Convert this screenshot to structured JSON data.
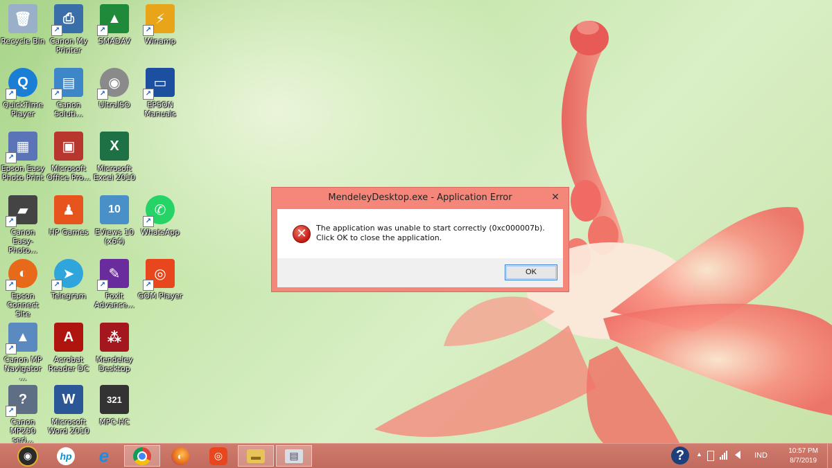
{
  "desktop_icons": [
    {
      "label": "Recycle Bin",
      "icon": "recycle-bin-icon",
      "color": "#9ab0c8",
      "glyph": "🗑"
    },
    {
      "label": "Canon My Printer",
      "icon": "printer-icon",
      "color": "#3a6ea8",
      "glyph": "⎙"
    },
    {
      "label": "SMADAV",
      "icon": "smadav-icon",
      "color": "#1f8a3a",
      "glyph": "▲"
    },
    {
      "label": "Winamp",
      "icon": "winamp-icon",
      "color": "#e8a51a",
      "glyph": "⚡"
    },
    {
      "label": "QuickTime Player",
      "icon": "quicktime-icon",
      "color": "#1a7fd4",
      "glyph": "Q"
    },
    {
      "label": "Canon Soluti...",
      "icon": "canon-solution-icon",
      "color": "#3d86c8",
      "glyph": "▤"
    },
    {
      "label": "UltraISO",
      "icon": "ultraiso-icon",
      "color": "#8a8a8a",
      "glyph": "◉"
    },
    {
      "label": "EPSON Manuals",
      "icon": "epson-manuals-icon",
      "color": "#1d4fa0",
      "glyph": "▭"
    },
    {
      "label": "Epson Easy Photo Print",
      "icon": "epson-photo-icon",
      "color": "#5b74b8",
      "glyph": "▦"
    },
    {
      "label": "Microsoft Office Pro...",
      "icon": "office-picture-icon",
      "color": "#b8362e",
      "glyph": "▣"
    },
    {
      "label": "Microsoft Excel 2010",
      "icon": "excel-icon",
      "color": "#1e7145",
      "glyph": "X"
    },
    {
      "label": "Canon Easy-Photo...",
      "icon": "canon-easy-photo-icon",
      "color": "#444",
      "glyph": "▰"
    },
    {
      "label": "HP Games",
      "icon": "hp-games-icon",
      "color": "#e8541e",
      "glyph": "♟"
    },
    {
      "label": "EViews 10 (x64)",
      "icon": "eviews-icon",
      "color": "#4a90c8",
      "glyph": "10"
    },
    {
      "label": "WhatsApp",
      "icon": "whatsapp-icon",
      "color": "#25d366",
      "glyph": "✆"
    },
    {
      "label": "Epson Connect Site",
      "icon": "firefox-icon",
      "color": "#e66a1a",
      "glyph": "◐"
    },
    {
      "label": "Telegram",
      "icon": "telegram-icon",
      "color": "#2ea6dc",
      "glyph": "➤"
    },
    {
      "label": "Foxit Advance...",
      "icon": "foxit-icon",
      "color": "#6a2b9c",
      "glyph": "✎"
    },
    {
      "label": "GOM Player",
      "icon": "gom-player-icon",
      "color": "#e8471e",
      "glyph": "◎"
    },
    {
      "label": "Canon MP Navigator ...",
      "icon": "canon-mp-navigator-icon",
      "color": "#5a8ac0",
      "glyph": "▲"
    },
    {
      "label": "Acrobat Reader DC",
      "icon": "acrobat-icon",
      "color": "#b0140e",
      "glyph": "A"
    },
    {
      "label": "Mendeley Desktop",
      "icon": "mendeley-icon",
      "color": "#a5171e",
      "glyph": "⁂"
    },
    {
      "label": "Canon MP250 seri...",
      "icon": "canon-help-icon",
      "color": "#5e6e84",
      "glyph": "?"
    },
    {
      "label": "Microsoft Word 2010",
      "icon": "word-icon",
      "color": "#2b5797",
      "glyph": "W"
    },
    {
      "label": "MPC-HC",
      "icon": "mpc-hc-icon",
      "color": "#333",
      "glyph": "321"
    }
  ],
  "dialog": {
    "title": "MendeleyDesktop.exe - Application Error",
    "message": "The application was unable to start correctly (0xc000007b). Click OK to close the application.",
    "ok_label": "OK",
    "close_glyph": "✕",
    "error_glyph": "✕"
  },
  "taskbar": {
    "apps": [
      {
        "name": "media-player-icon",
        "color": "#2a2a2a",
        "glyph": "◉"
      },
      {
        "name": "hp-icon",
        "color": "#ffffff",
        "glyph": "hp"
      },
      {
        "name": "internet-explorer-icon",
        "color": "#1c8ee0",
        "glyph": "e"
      },
      {
        "name": "chrome-icon",
        "color": "#dd4b39",
        "glyph": "◍"
      },
      {
        "name": "firefox-icon",
        "color": "#e66a1a",
        "glyph": "◐"
      },
      {
        "name": "gom-player-icon",
        "color": "#e8471e",
        "glyph": "◎"
      },
      {
        "name": "file-explorer-icon",
        "color": "#e8c35a",
        "glyph": "▬"
      },
      {
        "name": "application-window-icon",
        "color": "#d8dde3",
        "glyph": "▤"
      }
    ],
    "help_glyph": "?",
    "tray_up_glyph": "▲",
    "language": "IND",
    "time": "10:57 PM",
    "date": "8/7/2019"
  }
}
